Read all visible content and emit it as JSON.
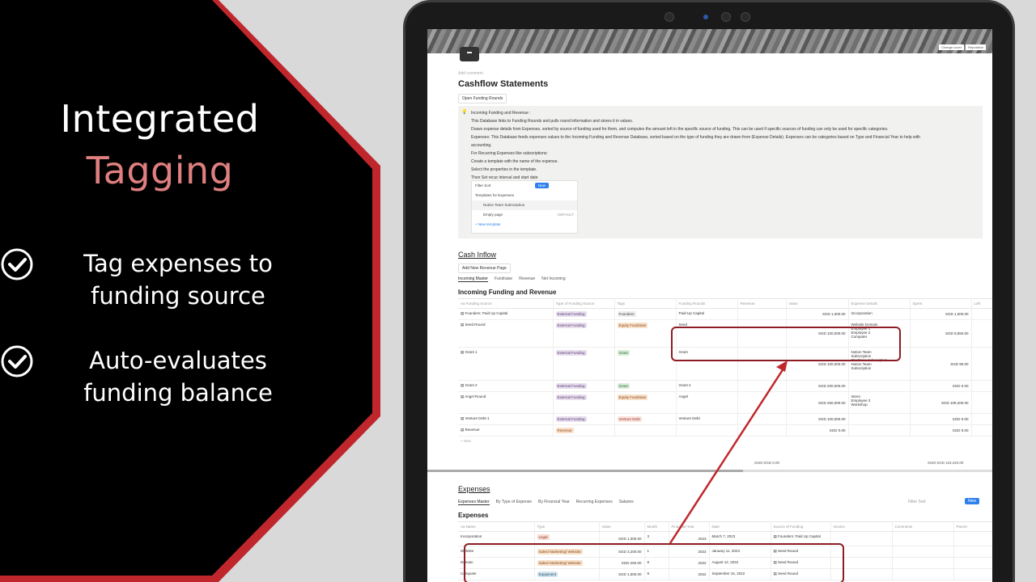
{
  "left": {
    "headline_1": "Integrated",
    "headline_2": "Tagging",
    "features": [
      {
        "line1": "Tag expenses to",
        "line2": "funding source"
      },
      {
        "line1": "Auto-evaluates",
        "line2": "funding balance"
      }
    ]
  },
  "page": {
    "cover_buttons": [
      "Change cover",
      "Reposition"
    ],
    "add_comment": "Add comment",
    "title": "Cashflow Statements",
    "open_rounds": "Open Funding Rounds",
    "callout_lines": [
      "Incoming Funding and Revenue :",
      "This Database links to Funding Rounds and pulls round information and stores it in values.",
      "Draws expense details from Expenses, sorted by source of funding used for them, and computes the amount left in the specific source of funding. This can be used if specific sources of funding can only be used for specific categories.",
      "Expenses: This Database feeds expenses values to the Incoming Funding and Revenue Database, sorted based on the type of funding they are drawn from (Expense Details). Expenses can be categories based on Type and Financial Year to help with",
      "accounting.",
      "For Recurring Expenses like subscriptions:",
      "Create a template with the name of the expense.",
      "Select the properties in the template.",
      "Then Set recur interval and start date"
    ],
    "template_box": {
      "toolbar": "Filter  Sort",
      "new_label": "New",
      "heading": "Templates for Expenses",
      "item1": "Notion Team Subscription",
      "item2": "Empty page",
      "default_label": "DEFAULT",
      "new_template": "+ New template"
    }
  },
  "inflow": {
    "section_title": "Cash Inflow",
    "add_button": "Add New Revenue Page",
    "views": [
      "Incoming Master",
      "Fundraise",
      "Revenue",
      "Net Incoming"
    ],
    "db_title": "Incoming Funding and Revenue",
    "columns": [
      "Aa Funding Source",
      "Type of Funding Source",
      "Tags",
      "Funding Rounds",
      "Revenue",
      "Value",
      "Expense Details",
      "Spent",
      "Left"
    ],
    "rows": [
      {
        "source": "Founders: Paid Up Capital",
        "type": "External Funding",
        "tag": "Founders",
        "tag_class": "tag-found",
        "round": "Paid-Up Capital",
        "value": "SGD 1,000.00",
        "details": [
          "Incorporation"
        ],
        "spent": "SGD 1,000.00"
      },
      {
        "source": "Seed Round",
        "type": "External Funding",
        "tag": "Equity Fundraise",
        "tag_class": "tag-eq",
        "round": "Seed",
        "value": "SGD 100,000.00",
        "details": [
          "Website   Domain",
          "Employee 1",
          "Employee 2",
          "Computer"
        ],
        "spent": "SGD 8,950.00"
      },
      {
        "source": "Grant 1",
        "type": "External Funding",
        "tag": "Grant",
        "tag_class": "tag-grant",
        "round": "Grant",
        "value": "SGD 100,000.00",
        "details": [
          "Notion Team",
          "Subscription",
          "OneDrive Subscription",
          "Notion Team",
          "Subscription"
        ],
        "spent": "SGD 90.00"
      },
      {
        "source": "Grant 2",
        "type": "External Funding",
        "tag": "Grant",
        "tag_class": "tag-grant",
        "round": "Grant 2",
        "value": "SGD 200,000.00",
        "details": [],
        "spent": "SGD 0.00"
      },
      {
        "source": "Angel Round",
        "type": "External Funding",
        "tag": "Equity Fundraise",
        "tag_class": "tag-eq",
        "round": "Angel",
        "value": "SGD 250,000.00",
        "details": [
          "Intern",
          "Employee 3",
          "Workshop"
        ],
        "spent": "SGD 109,200.00"
      },
      {
        "source": "Venture Debt 1",
        "type": "External Funding",
        "tag": "Venture Debt",
        "tag_class": "tag-vd",
        "round": "Venture Debt",
        "value": "SGD 100,000.00",
        "details": [],
        "spent": "SGD 0.00"
      },
      {
        "source": "Revenue",
        "type": "Revenue",
        "tag": "",
        "tag_class": "",
        "round": "",
        "value": "SGD 0.00",
        "details": [],
        "spent": "SGD 0.00"
      }
    ],
    "new_row": "+ New",
    "sum_revenue": "SUM SGD 0.00",
    "sum_spent": "SUM SGD 119,240.00"
  },
  "expenses": {
    "section_title": "Expenses",
    "views": [
      "Expenses Master",
      "By Type of Expense",
      "By Financial Year",
      "Recurring Expenses",
      "Salaries"
    ],
    "toolbar": "Filter  Sort",
    "new_label": "New",
    "db_title": "Expenses",
    "columns": [
      "Aa Name",
      "Type",
      "Value",
      "Month",
      "Financial Year",
      "Date",
      "Source of Funding",
      "Invoice",
      "Comments",
      "Parent"
    ],
    "rows": [
      {
        "name": "Incorporation",
        "type": "Legal",
        "type_class": "tag-legal",
        "value": "SGD 1,000.00",
        "month": "3",
        "fy": "2023",
        "date": "March 7, 2023",
        "source": "Founders: Paid Up Capital"
      },
      {
        "name": "Website",
        "type": "Sales/ Marketing/ Website",
        "type_class": "tag-sales",
        "value": "SGD 3,200.00",
        "month": "1",
        "fy": "2023",
        "date": "January 11, 2023",
        "source": "Seed Round"
      },
      {
        "name": "Domain",
        "type": "Sales/ Marketing/ Website",
        "type_class": "tag-sales",
        "value": "SGD 250.00",
        "month": "8",
        "fy": "2022",
        "date": "August 12, 2022",
        "source": "Seed Round"
      },
      {
        "name": "Computer",
        "type": "Equipment",
        "type_class": "tag-equip",
        "value": "SGD 1,500.00",
        "month": "9",
        "fy": "2022",
        "date": "September 15, 2022",
        "source": "Seed Round"
      }
    ]
  },
  "colors": {
    "accent": "#c0272d",
    "highlight_box": "#8e1c24",
    "panel": "#000000"
  }
}
